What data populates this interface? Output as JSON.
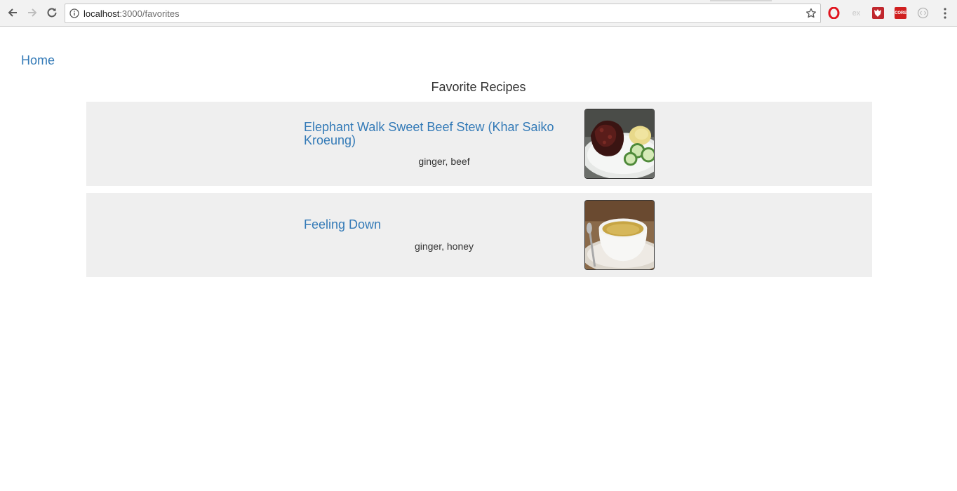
{
  "browser": {
    "url_host": "localhost",
    "url_path": ":3000/favorites",
    "extensions": {
      "ex_label": "ex",
      "cors_label": "CORS"
    }
  },
  "nav": {
    "home_label": "Home"
  },
  "page": {
    "title": "Favorite Recipes"
  },
  "recipes": [
    {
      "title": "Elephant Walk Sweet Beef Stew (Khar Saiko Kroeung)",
      "ingredients": "ginger, beef"
    },
    {
      "title": "Feeling Down",
      "ingredients": "ginger, honey"
    }
  ]
}
